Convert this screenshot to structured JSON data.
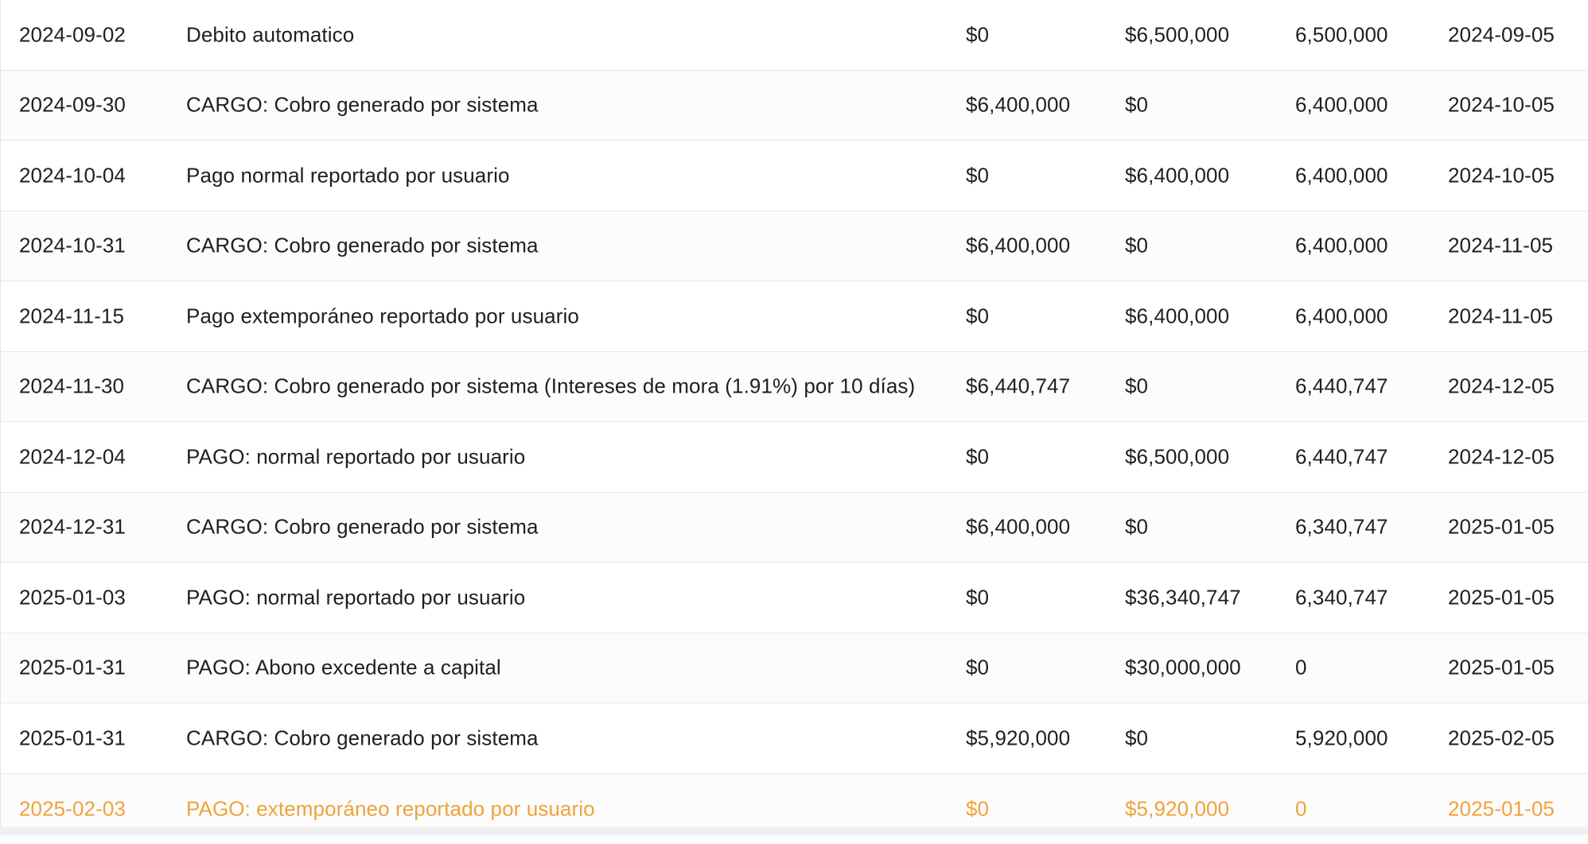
{
  "table": {
    "rows": [
      {
        "date": "2024-09-02",
        "description": "Debito automatico",
        "charge": "$0",
        "payment": "$6,500,000",
        "balance": "6,500,000",
        "due_date": "2024-09-05"
      },
      {
        "date": "2024-09-30",
        "description": "CARGO: Cobro generado por sistema",
        "charge": "$6,400,000",
        "payment": "$0",
        "balance": "6,400,000",
        "due_date": "2024-10-05"
      },
      {
        "date": "2024-10-04",
        "description": "Pago normal reportado por usuario",
        "charge": "$0",
        "payment": "$6,400,000",
        "balance": "6,400,000",
        "due_date": "2024-10-05"
      },
      {
        "date": "2024-10-31",
        "description": "CARGO: Cobro generado por sistema",
        "charge": "$6,400,000",
        "payment": "$0",
        "balance": "6,400,000",
        "due_date": "2024-11-05"
      },
      {
        "date": "2024-11-15",
        "description": "Pago extemporáneo reportado por usuario",
        "charge": "$0",
        "payment": "$6,400,000",
        "balance": "6,400,000",
        "due_date": "2024-11-05"
      },
      {
        "date": "2024-11-30",
        "description": "CARGO: Cobro generado por sistema (Intereses de mora (1.91%) por 10 días)",
        "charge": "$6,440,747",
        "payment": "$0",
        "balance": "6,440,747",
        "due_date": "2024-12-05"
      },
      {
        "date": "2024-12-04",
        "description": "PAGO: normal reportado por usuario",
        "charge": "$0",
        "payment": "$6,500,000",
        "balance": "6,440,747",
        "due_date": "2024-12-05"
      },
      {
        "date": "2024-12-31",
        "description": "CARGO: Cobro generado por sistema",
        "charge": "$6,400,000",
        "payment": "$0",
        "balance": "6,340,747",
        "due_date": "2025-01-05"
      },
      {
        "date": "2025-01-03",
        "description": "PAGO: normal reportado por usuario",
        "charge": "$0",
        "payment": "$36,340,747",
        "balance": "6,340,747",
        "due_date": "2025-01-05"
      },
      {
        "date": "2025-01-31",
        "description": "PAGO: Abono excedente a capital",
        "charge": "$0",
        "payment": "$30,000,000",
        "balance": "0",
        "due_date": "2025-01-05"
      },
      {
        "date": "2025-01-31",
        "description": "CARGO: Cobro generado por sistema",
        "charge": "$5,920,000",
        "payment": "$0",
        "balance": "5,920,000",
        "due_date": "2025-02-05"
      },
      {
        "date": "2025-02-03",
        "description": "PAGO: extemporáneo reportado por usuario",
        "charge": "$0",
        "payment": "$5,920,000",
        "balance": "0",
        "due_date": "2025-01-05",
        "status": "warning"
      }
    ]
  },
  "colors": {
    "text": "#1f1f1f",
    "warning": "#f0a23a",
    "border": "#e6e6e6"
  }
}
